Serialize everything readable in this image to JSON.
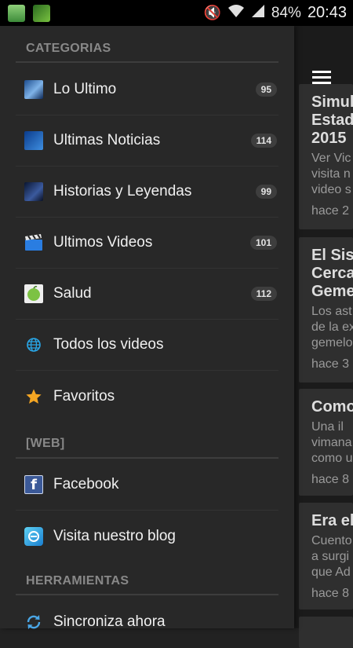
{
  "status_bar": {
    "battery": "84%",
    "time": "20:43",
    "icons": [
      "app-notification-icon",
      "satellite-icon",
      "mute-icon",
      "wifi-icon",
      "signal-icon"
    ]
  },
  "drawer": {
    "sections": [
      {
        "header": "CATEGORIAS",
        "items": [
          {
            "label": "Lo Ultimo",
            "count": "95",
            "icon": "lo-ultimo-icon"
          },
          {
            "label": "Ultimas Noticias",
            "count": "114",
            "icon": "noticias-icon"
          },
          {
            "label": "Historias y Leyendas",
            "count": "99",
            "icon": "historias-icon"
          },
          {
            "label": "Ultimos Videos",
            "count": "101",
            "icon": "video-clapper-icon"
          },
          {
            "label": "Salud",
            "count": "112",
            "icon": "salud-icon"
          },
          {
            "label": "Todos los videos",
            "count": "",
            "icon": "globe-icon"
          },
          {
            "label": "Favoritos",
            "count": "",
            "icon": "star-icon"
          }
        ]
      },
      {
        "header": "[WEB]",
        "items": [
          {
            "label": "Facebook",
            "icon": "facebook-icon"
          },
          {
            "label": "Visita nuestro blog",
            "icon": "blog-icon"
          }
        ]
      },
      {
        "header": "HERRAMIENTAS",
        "items": [
          {
            "label": "Sincroniza ahora",
            "icon": "sync-icon"
          }
        ]
      }
    ]
  },
  "content": {
    "cards": [
      {
        "title_lines": [
          "Simul",
          "Estad",
          "2015"
        ],
        "excerpt_lines": [
          "Ver Vic",
          "visita n",
          "video s"
        ],
        "time": "hace 2"
      },
      {
        "title_lines": [
          "El Sist",
          "Cerca",
          "Geme"
        ],
        "excerpt_lines": [
          "Los ast",
          "de la ex",
          "gemelo"
        ],
        "time": "hace 3"
      },
      {
        "title_lines": [
          "Como"
        ],
        "excerpt_lines": [
          " Una il",
          "vimana",
          "como u"
        ],
        "time": "hace 8"
      },
      {
        "title_lines": [
          "Era el"
        ],
        "excerpt_lines": [
          "Cuento",
          "a surgi",
          "que Ad"
        ],
        "time": "hace 8"
      }
    ]
  },
  "colors": {
    "drawer_bg": "#282828",
    "status_bar_bg": "#000000",
    "badge_bg": "#3e3e3e",
    "card_bg": "#2f2f2f"
  }
}
